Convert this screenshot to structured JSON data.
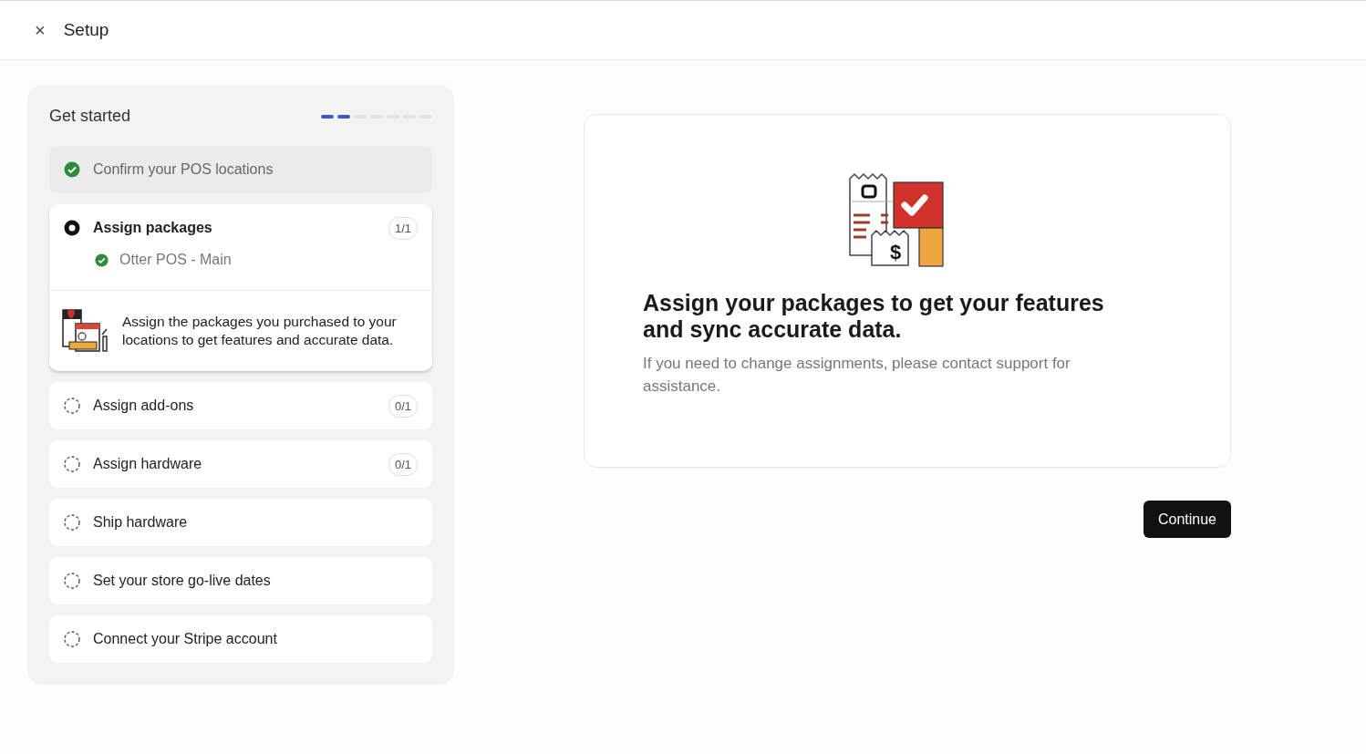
{
  "header": {
    "close": "×",
    "title": "Setup"
  },
  "panel": {
    "title": "Get started",
    "progress": [
      {
        "done": true
      },
      {
        "done": true
      },
      {
        "done": false
      },
      {
        "done": false
      },
      {
        "done": false
      },
      {
        "done": false
      },
      {
        "done": false
      }
    ]
  },
  "steps": [
    {
      "label": "Confirm your POS locations",
      "completed": true,
      "active": false
    },
    {
      "label": "Assign packages",
      "completed": false,
      "active": true,
      "count": "1/1",
      "children": [
        {
          "label": "Otter POS - Main",
          "completed": true
        }
      ],
      "description": "Assign the packages you purchased to your locations to get features and accurate data."
    },
    {
      "label": "Assign add-ons",
      "completed": false,
      "active": false,
      "count": "0/1"
    },
    {
      "label": "Assign hardware",
      "completed": false,
      "active": false,
      "count": "0/1"
    },
    {
      "label": "Ship hardware",
      "completed": false,
      "active": false
    },
    {
      "label": "Set your store go-live dates",
      "completed": false,
      "active": false
    },
    {
      "label": "Connect your Stripe account",
      "completed": false,
      "active": false
    }
  ],
  "card": {
    "illustration_symbol": "$",
    "heading": "Assign your packages to get your features and sync accurate data.",
    "body": "If you need to change assignments, please contact support for assistance."
  },
  "continue_button": "Continue"
}
